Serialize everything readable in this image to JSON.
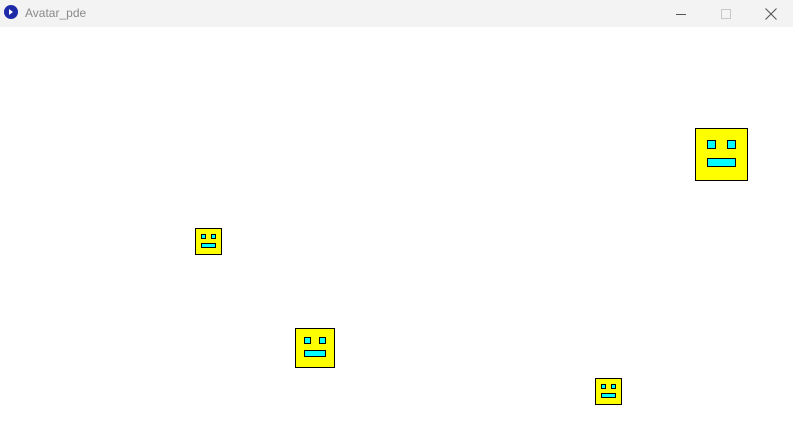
{
  "window": {
    "title": "Avatar_pde",
    "app_icon": "processing-app-icon",
    "controls": {
      "minimize_icon": "minimize-icon",
      "maximize_icon": "maximize-icon",
      "close_icon": "close-icon"
    }
  },
  "canvas": {
    "background": "#ffffff",
    "avatar_fill": "#ffff00",
    "feature_fill": "#00ffff",
    "outline": "#000000"
  }
}
